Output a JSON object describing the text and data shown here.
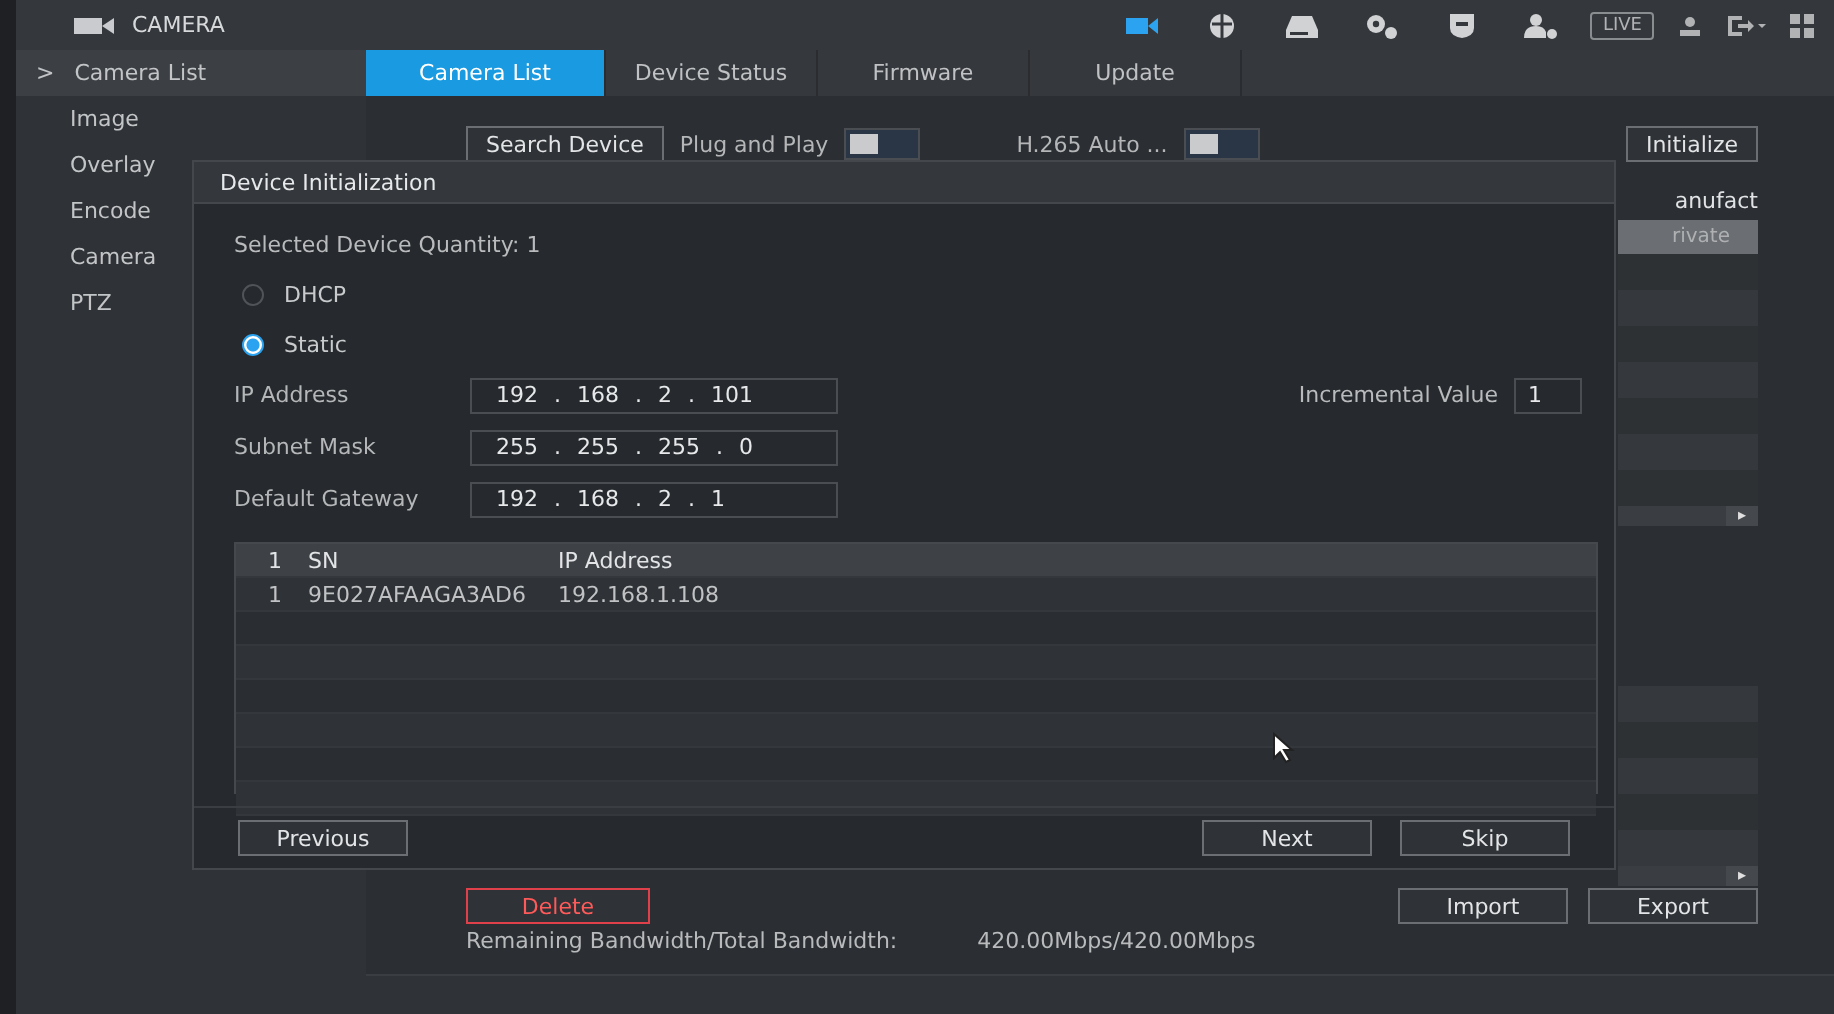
{
  "header": {
    "title": "CAMERA",
    "live": "LIVE"
  },
  "top_icons": [
    {
      "kind": "camera",
      "selected": true
    },
    {
      "kind": "network",
      "selected": false
    },
    {
      "kind": "storage",
      "selected": false
    },
    {
      "kind": "system",
      "selected": false
    },
    {
      "kind": "security",
      "selected": false
    },
    {
      "kind": "account",
      "selected": false
    }
  ],
  "sidebar": {
    "items": [
      {
        "label": "Camera List",
        "selected": true,
        "chevron": ">"
      },
      {
        "label": "Image",
        "selected": false
      },
      {
        "label": "Overlay",
        "selected": false
      },
      {
        "label": "Encode",
        "selected": false
      },
      {
        "label": "Camera",
        "selected": false
      },
      {
        "label": "PTZ",
        "selected": false
      }
    ]
  },
  "tabs": [
    {
      "label": "Camera List",
      "selected": true
    },
    {
      "label": "Device Status",
      "selected": false
    },
    {
      "label": "Firmware",
      "selected": false
    },
    {
      "label": "Update",
      "selected": false
    }
  ],
  "toolbar": {
    "search_button": "Search Device",
    "toggles": [
      {
        "label": "Plug and Play",
        "on": false
      },
      {
        "label": "H.265 Auto ...",
        "on": false
      }
    ],
    "initialize_button": "Initialize"
  },
  "device_table": {
    "column_header": "anufact",
    "row_cell": "rivate",
    "scroll_arrow": "▸"
  },
  "lower_table": {
    "scroll_arrow": "▸"
  },
  "dialog": {
    "title": "Device Initialization",
    "quantity": "Selected Device Quantity: 1",
    "modes": [
      {
        "label": "DHCP",
        "selected": false
      },
      {
        "label": "Static",
        "selected": true
      }
    ],
    "fields": [
      {
        "label": "IP Address",
        "parts": [
          "192",
          ".",
          "168",
          ".",
          "2",
          ".",
          "101"
        ]
      },
      {
        "label": "Subnet Mask",
        "parts": [
          "255",
          ".",
          "255",
          ".",
          "255",
          ".",
          "0"
        ]
      },
      {
        "label": "Default Gateway",
        "parts": [
          "192",
          ".",
          "168",
          ".",
          "2",
          ".",
          "1"
        ]
      }
    ],
    "incremental": {
      "label": "Incremental Value",
      "value": "1"
    },
    "table": {
      "columns": [
        "1",
        "SN",
        "IP Address"
      ],
      "rows": [
        [
          "1",
          "9E027AFAAGA3AD6",
          "192.168.1.108"
        ]
      ]
    },
    "previous": "Previous",
    "next": "Next",
    "skip": "Skip"
  },
  "footer": {
    "delete": "Delete",
    "import": "Import",
    "export": "Export",
    "bandwidth_label": "Remaining Bandwidth/Total Bandwidth:",
    "bandwidth_value": "420.00Mbps/420.00Mbps"
  }
}
